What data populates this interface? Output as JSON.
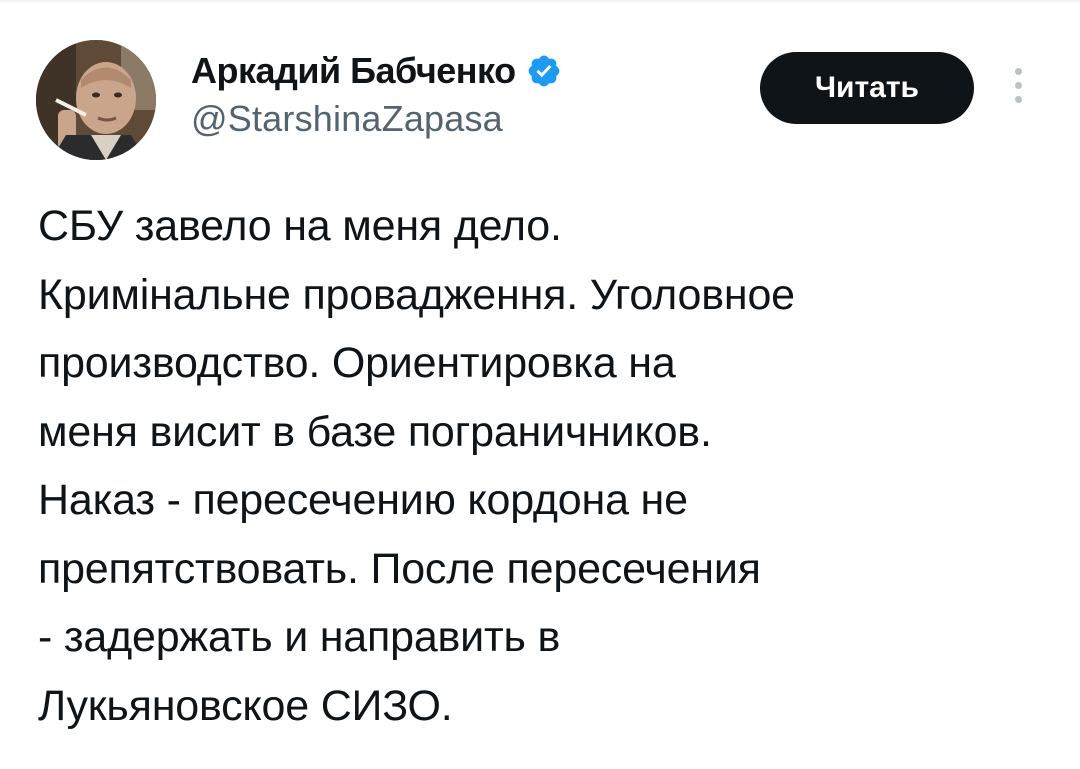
{
  "tweet": {
    "author": {
      "display_name": "Аркадий Бабченко",
      "handle": "@StarshinaZapasa",
      "verified": true,
      "verified_icon": "verified-badge-icon",
      "avatar_icon": "profile-photo"
    },
    "follow_label": "Читать",
    "more_icon": "more-vertical-icon",
    "body_lines": [
      "СБУ завело на меня дело.",
      "Кримінальне провадження. Уголовное",
      "производство. Ориентировка на",
      "меня висит в базе пограничников.",
      "Наказ - пересечению кордона не",
      "препятствовать. После пересечения",
      "- задержать и направить в",
      "Лукьяновское СИЗО."
    ]
  },
  "colors": {
    "text": "#0f1419",
    "secondary_text": "#536471",
    "verified_blue": "#1d9bf0",
    "button_bg": "#0f1419",
    "button_text": "#ffffff",
    "divider": "#eff3f4"
  }
}
